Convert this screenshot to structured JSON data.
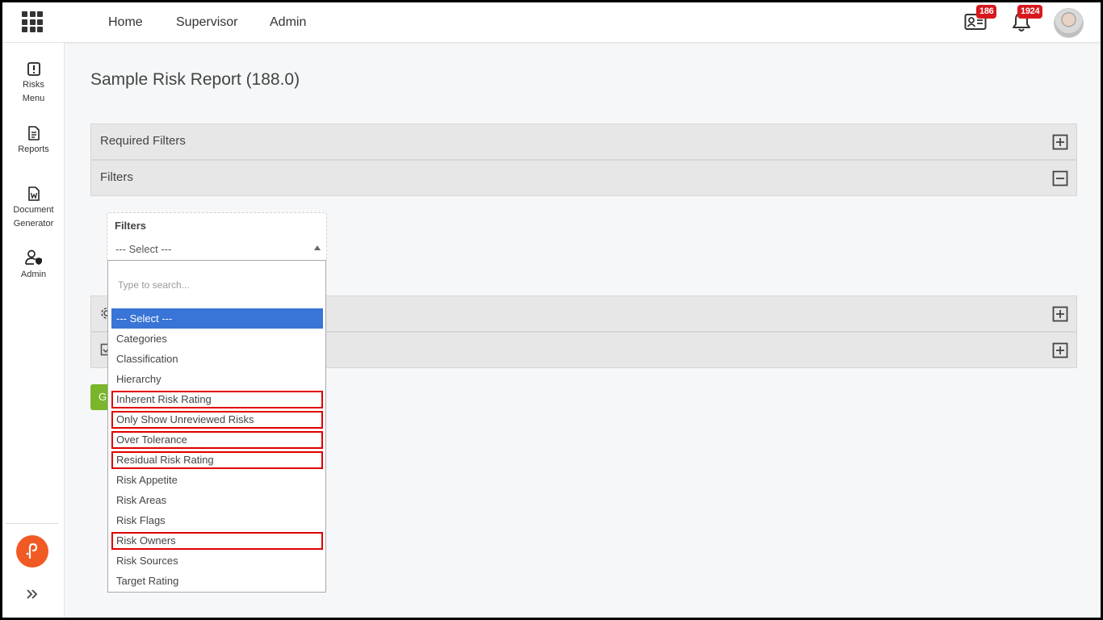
{
  "topbar": {
    "nav": [
      "Home",
      "Supervisor",
      "Admin"
    ],
    "messages_badge": "186",
    "notifications_badge": "1924"
  },
  "sidebar": {
    "items": [
      {
        "label_line1": "Risks",
        "label_line2": "Menu",
        "icon": "alert-square-icon"
      },
      {
        "label_line1": "Reports",
        "label_line2": "",
        "icon": "document-icon"
      },
      {
        "label_line1": "Document",
        "label_line2": "Generator",
        "icon": "word-document-icon"
      },
      {
        "label_line1": "Admin",
        "label_line2": "",
        "icon": "user-shield-icon"
      }
    ],
    "logo_color": "#f15a22"
  },
  "main": {
    "title": "Sample Risk Report (188.0)",
    "panels": [
      {
        "title": "Required Filters",
        "state": "collapsed"
      },
      {
        "title": "Filters",
        "state": "expanded"
      },
      {
        "title": "",
        "state": "collapsed"
      },
      {
        "title": "",
        "state": "collapsed"
      }
    ],
    "generate_button_label": "G"
  },
  "filters": {
    "label": "Filters",
    "selected_value": "--- Select ---",
    "search_placeholder": "Type to search...",
    "options": [
      {
        "label": "--- Select ---",
        "selected": true,
        "highlighted": false
      },
      {
        "label": "Categories",
        "selected": false,
        "highlighted": false
      },
      {
        "label": "Classification",
        "selected": false,
        "highlighted": false
      },
      {
        "label": "Hierarchy",
        "selected": false,
        "highlighted": false
      },
      {
        "label": "Inherent Risk Rating",
        "selected": false,
        "highlighted": true
      },
      {
        "label": "Only Show Unreviewed Risks",
        "selected": false,
        "highlighted": true
      },
      {
        "label": "Over Tolerance",
        "selected": false,
        "highlighted": true
      },
      {
        "label": "Residual Risk Rating",
        "selected": false,
        "highlighted": true
      },
      {
        "label": "Risk Appetite",
        "selected": false,
        "highlighted": false
      },
      {
        "label": "Risk Areas",
        "selected": false,
        "highlighted": false
      },
      {
        "label": "Risk Flags",
        "selected": false,
        "highlighted": false
      },
      {
        "label": "Risk Owners",
        "selected": false,
        "highlighted": true
      },
      {
        "label": "Risk Sources",
        "selected": false,
        "highlighted": false
      },
      {
        "label": "Target Rating",
        "selected": false,
        "highlighted": false
      }
    ]
  },
  "colors": {
    "selected_option": "#3875d7",
    "highlight_outline": "#e00000",
    "badge": "#d7191e",
    "generate_button": "#7ab52c"
  }
}
